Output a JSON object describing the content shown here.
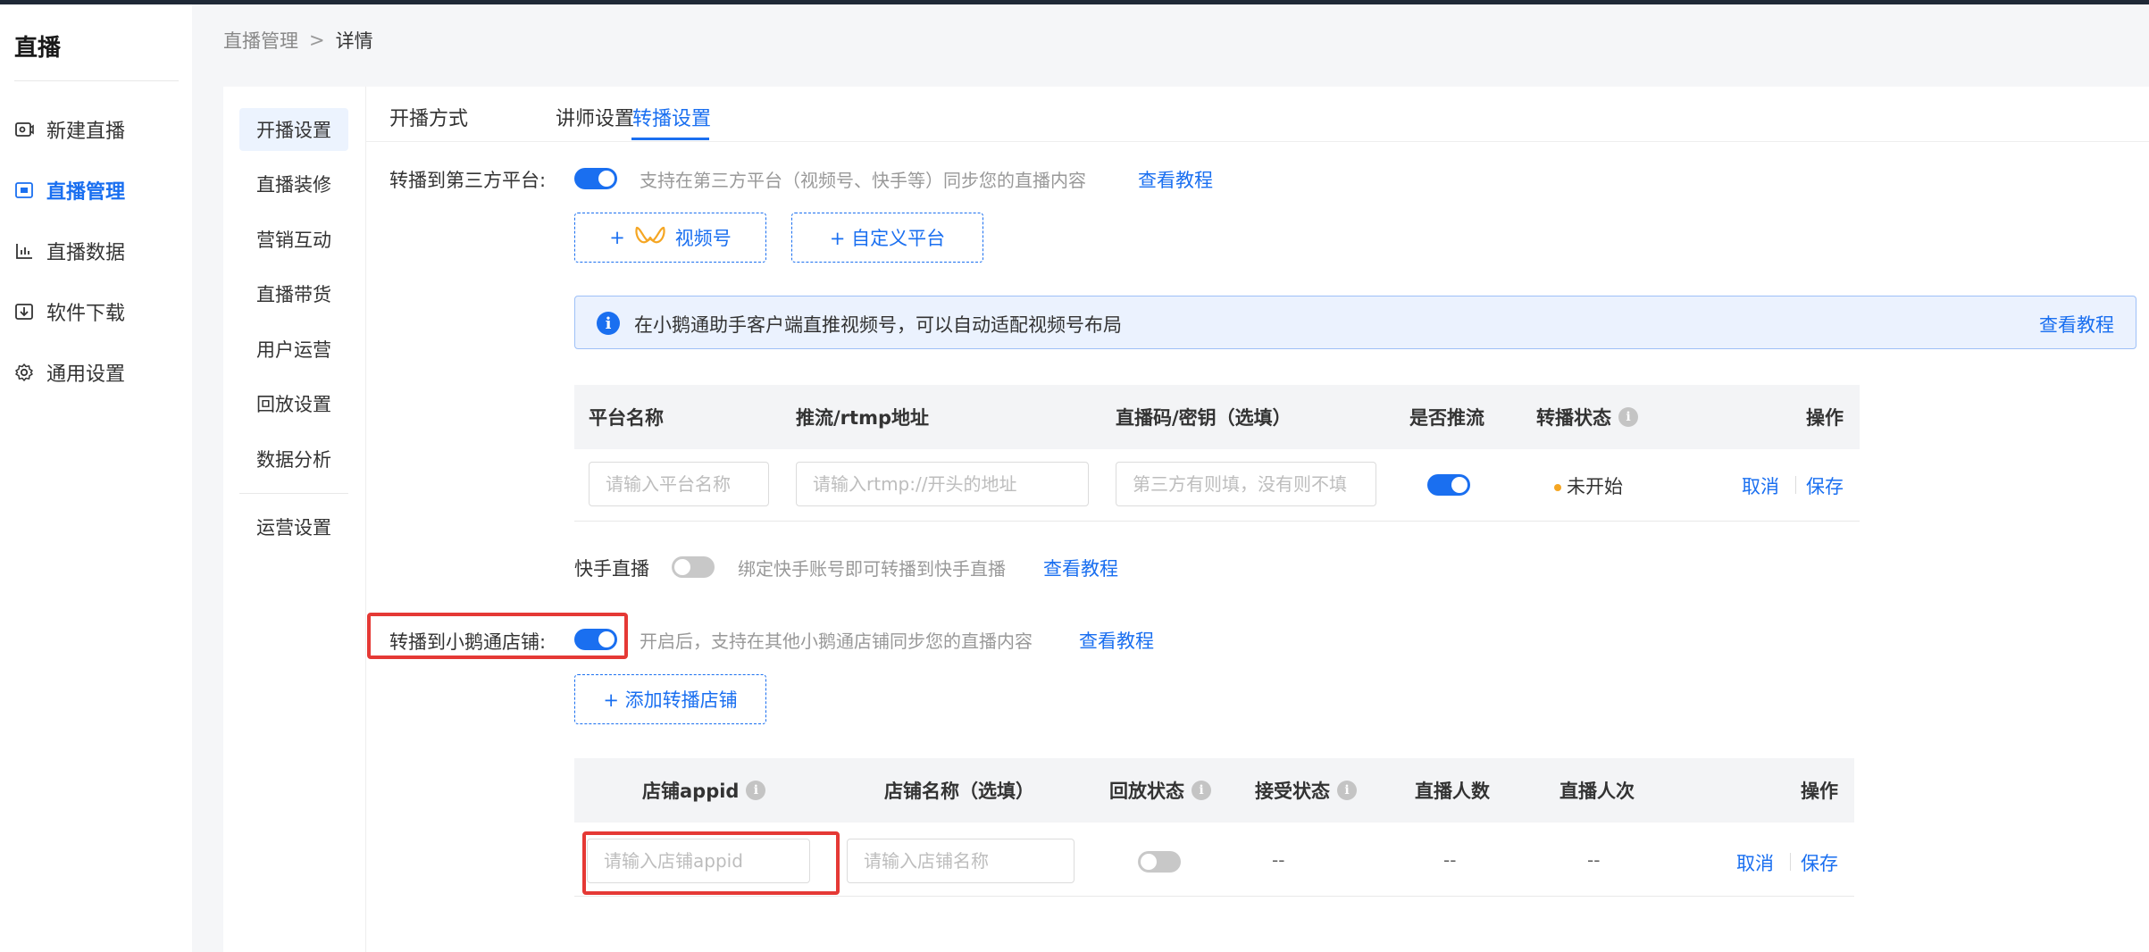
{
  "sidebar": {
    "title": "直播",
    "items": [
      {
        "label": "新建直播",
        "icon": "new-live-icon"
      },
      {
        "label": "直播管理",
        "icon": "live-manage-icon",
        "active": true
      },
      {
        "label": "直播数据",
        "icon": "chart-icon"
      },
      {
        "label": "软件下载",
        "icon": "download-icon"
      },
      {
        "label": "通用设置",
        "icon": "gear-icon"
      }
    ]
  },
  "breadcrumb": {
    "parent": "直播管理",
    "separator": ">",
    "current": "详情"
  },
  "subnav": {
    "items": [
      "开播设置",
      "直播装修",
      "营销互动",
      "直播带货",
      "用户运营",
      "回放设置",
      "数据分析"
    ],
    "extra": "运营设置",
    "active_index": 0
  },
  "tabs": [
    {
      "label": "开播方式"
    },
    {
      "label": "讲师设置"
    },
    {
      "label": "转播设置",
      "active": true
    }
  ],
  "third_party": {
    "label": "转播到第三方平台:",
    "enabled": true,
    "desc": "支持在第三方平台（视频号、快手等）同步您的直播内容",
    "link": "查看教程",
    "buttons": {
      "plus": "+",
      "video": "视频号",
      "custom": "+ 自定义平台"
    }
  },
  "info": {
    "text": "在小鹅通助手客户端直推视频号，可以自动适配视频号布局",
    "link": "查看教程"
  },
  "platform_table": {
    "headers": {
      "name": "平台名称",
      "rtmp": "推流/rtmp地址",
      "key": "直播码/密钥（选填）",
      "push": "是否推流",
      "status": "转播状态",
      "ops": "操作"
    },
    "row": {
      "name_placeholder": "请输入平台名称",
      "rtmp_placeholder": "请输入rtmp://开头的地址",
      "key_placeholder": "第三方有则填，没有则不填",
      "push": true,
      "status": "未开始",
      "cancel": "取消",
      "save": "保存"
    }
  },
  "kuaishou": {
    "label": "快手直播",
    "enabled": false,
    "desc": "绑定快手账号即可转播到快手直播",
    "link": "查看教程"
  },
  "store": {
    "label": "转播到小鹅通店铺:",
    "enabled": true,
    "desc": "开启后，支持在其他小鹅通店铺同步您的直播内容",
    "link": "查看教程",
    "add_button": "+ 添加转播店铺"
  },
  "store_table": {
    "headers": {
      "appid": "店铺appid",
      "name": "店铺名称（选填）",
      "replay": "回放状态",
      "accept": "接受状态",
      "viewers": "直播人数",
      "visits": "直播人次",
      "ops": "操作"
    },
    "row": {
      "appid_placeholder": "请输入店铺appid",
      "name_placeholder": "请输入店铺名称",
      "replay": false,
      "accept": "--",
      "viewers": "--",
      "visits": "--",
      "cancel": "取消",
      "save": "保存"
    }
  },
  "colors": {
    "accent": "#1a6ff0",
    "highlight": "#e53935",
    "status_pending": "#f5a623"
  }
}
